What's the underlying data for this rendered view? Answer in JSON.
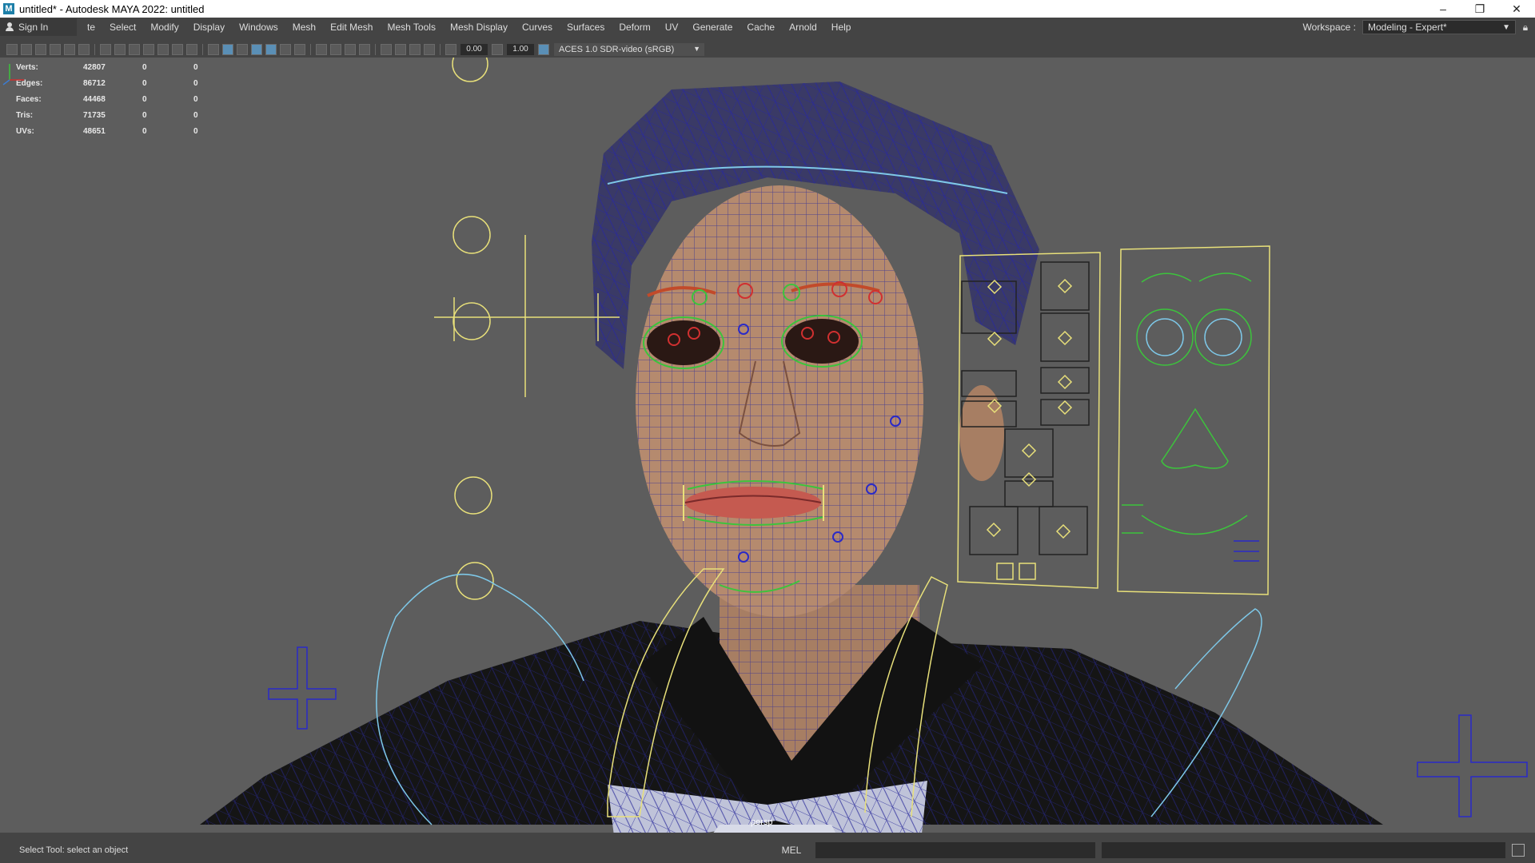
{
  "window": {
    "app_icon_letter": "M",
    "title": "untitled* - Autodesk MAYA 2022: untitled",
    "minimize": "–",
    "restore": "❐",
    "close": "✕"
  },
  "menubar": {
    "sign_in": "Sign In",
    "items": [
      "te",
      "Select",
      "Modify",
      "Display",
      "Windows",
      "Mesh",
      "Edit Mesh",
      "Mesh Tools",
      "Mesh Display",
      "Curves",
      "Surfaces",
      "Deform",
      "UV",
      "Generate",
      "Cache",
      "Arnold",
      "Help"
    ],
    "workspace_label": "Workspace :",
    "workspace_value": "Modeling - Expert*"
  },
  "toolbar": {
    "exposure": "0.00",
    "gamma": "1.00",
    "color_space": "ACES 1.0 SDR-video (sRGB)"
  },
  "hud": {
    "rows": [
      {
        "label": "Verts:",
        "v1": "42807",
        "v2": "0",
        "v3": "0"
      },
      {
        "label": "Edges:",
        "v1": "86712",
        "v2": "0",
        "v3": "0"
      },
      {
        "label": "Faces:",
        "v1": "44468",
        "v2": "0",
        "v3": "0"
      },
      {
        "label": "Tris:",
        "v1": "71735",
        "v2": "0",
        "v3": "0"
      },
      {
        "label": "UVs:",
        "v1": "48651",
        "v2": "0",
        "v3": "0"
      }
    ]
  },
  "viewport": {
    "camera": "persp",
    "colors": {
      "background": "#5d5d5d",
      "wire": "#2a2a9a",
      "skin": "#b58a6e",
      "control_yellow": "#e8e07a",
      "control_green": "#3cc43c",
      "control_cyan": "#7ec8e8",
      "control_blue": "#2a2ac8",
      "control_red": "#d03030"
    }
  },
  "statusbar": {
    "message": "Select Tool: select an object",
    "mel": "MEL"
  }
}
